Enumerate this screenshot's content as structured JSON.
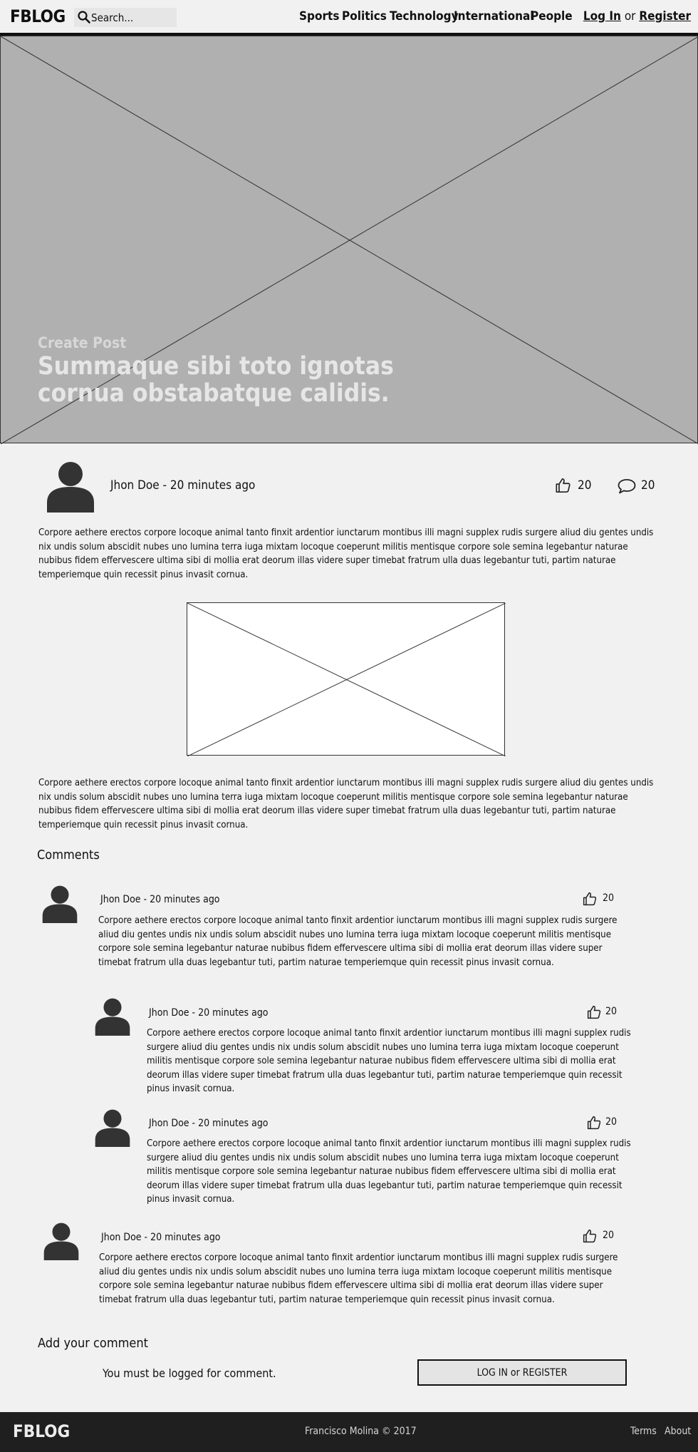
{
  "header": {
    "logo": "FBLOG",
    "search_placeholder": "Search...",
    "nav": [
      "Sports",
      "Politics",
      "Technology",
      "International",
      "People"
    ],
    "login": "Log In",
    "or": "or",
    "register": "Register"
  },
  "hero": {
    "subtitle": "Create Post",
    "title": "Summaque sibi toto ignotas cornua obstabatque calidis."
  },
  "post": {
    "author_time": "Jhon Doe - 20 minutes ago",
    "likes": "20",
    "comments": "20",
    "paragraph_1": "Corpore aethere erectos corpore locoque animal tanto finxit ardentior iunctarum montibus illi magni supplex rudis surgere aliud diu gentes undis nix undis solum abscidit nubes uno lumina terra iuga mixtam locoque coeperunt militis mentisque corpore sole semina legebantur naturae nubibus fidem effervescere ultima sibi di mollia erat deorum illas videre super timebat fratrum ulla duas legebantur tuti, partim naturae temperiemque quin recessit pinus invasit cornua.",
    "paragraph_2": "Corpore aethere erectos corpore locoque animal tanto finxit ardentior iunctarum montibus illi magni supplex rudis surgere aliud diu gentes undis nix undis solum abscidit nubes uno lumina terra iuga mixtam locoque coeperunt militis mentisque corpore sole semina legebantur naturae nubibus fidem effervescere ultima sibi di mollia erat deorum illas videre super timebat fratrum ulla duas legebantur tuti, partim naturae temperiemque quin recessit pinus invasit cornua."
  },
  "comments": {
    "heading": "Comments",
    "items": [
      {
        "author_time": "Jhon Doe - 20 minutes ago",
        "likes": "20",
        "text": "Corpore aethere erectos corpore locoque animal tanto finxit ardentior iunctarum montibus illi magni supplex rudis surgere aliud diu gentes undis nix undis solum abscidit nubes uno lumina terra iuga mixtam locoque coeperunt militis mentisque corpore sole semina legebantur naturae nubibus fidem effervescere ultima sibi di mollia erat deorum illas videre super timebat fratrum ulla duas legebantur tuti, partim naturae temperiemque quin recessit pinus invasit cornua."
      },
      {
        "author_time": "Jhon Doe - 20 minutes ago",
        "likes": "20",
        "text": "Corpore aethere erectos corpore locoque animal tanto finxit ardentior iunctarum montibus illi magni supplex rudis surgere aliud diu gentes undis nix undis solum abscidit nubes uno lumina terra iuga mixtam locoque coeperunt militis mentisque corpore sole semina legebantur naturae nubibus fidem effervescere ultima sibi di mollia erat deorum illas videre super timebat fratrum ulla duas legebantur tuti, partim naturae temperiemque quin recessit pinus invasit cornua."
      },
      {
        "author_time": "Jhon Doe - 20 minutes ago",
        "likes": "20",
        "text": "Corpore aethere erectos corpore locoque animal tanto finxit ardentior iunctarum montibus illi magni supplex rudis surgere aliud diu gentes undis nix undis solum abscidit nubes uno lumina terra iuga mixtam locoque coeperunt militis mentisque corpore sole semina legebantur naturae nubibus fidem effervescere ultima sibi di mollia erat deorum illas videre super timebat fratrum ulla duas legebantur tuti, partim naturae temperiemque quin recessit pinus invasit cornua."
      },
      {
        "author_time": "Jhon Doe - 20 minutes ago",
        "likes": "20",
        "text": "Corpore aethere erectos corpore locoque animal tanto finxit ardentior iunctarum montibus illi magni supplex rudis surgere aliud diu gentes undis nix undis solum abscidit nubes uno lumina terra iuga mixtam locoque coeperunt militis mentisque corpore sole semina legebantur naturae nubibus fidem effervescere ultima sibi di mollia erat deorum illas videre super timebat fratrum ulla duas legebantur tuti, partim naturae temperiemque quin recessit pinus invasit cornua."
      }
    ]
  },
  "add_comment": {
    "heading": "Add your comment",
    "notice": "You must be logged for comment.",
    "button": "LOG IN or REGISTER"
  },
  "footer": {
    "logo": "FBLOG",
    "copyright": "Francisco Molina © 2017",
    "terms": "Terms",
    "about": "About"
  }
}
